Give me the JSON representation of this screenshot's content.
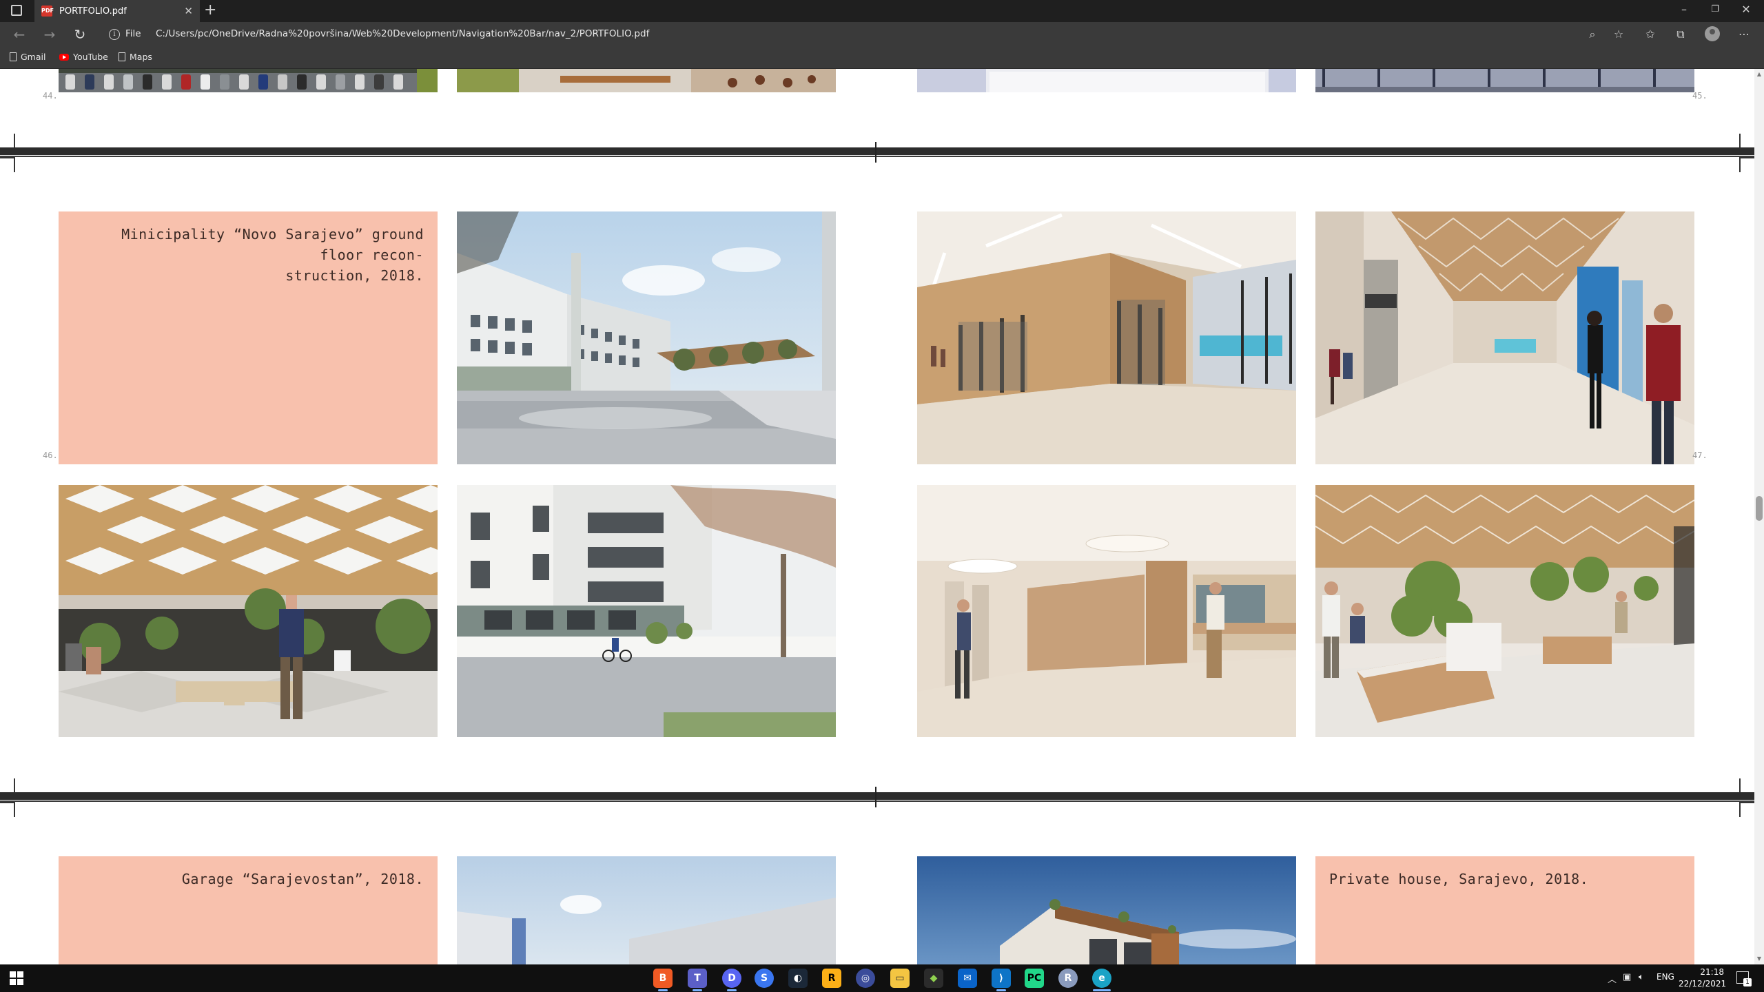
{
  "browser": {
    "tab_title": "PORTFOLIO.pdf",
    "protocol_label": "File",
    "url": "C:/Users/pc/OneDrive/Radna%20površina/Web%20Development/Navigation%20Bar/nav_2/PORTFOLIO.pdf",
    "bookmarks": [
      {
        "label": "Gmail",
        "icon": "page-icon"
      },
      {
        "label": "YouTube",
        "icon": "youtube-icon"
      },
      {
        "label": "Maps",
        "icon": "page-icon"
      }
    ]
  },
  "pdf": {
    "page_numbers": {
      "p44": "44.",
      "p45": "45.",
      "p46": "46.",
      "p47": "47."
    },
    "projects": [
      {
        "label": "Minicipality “Novo Sarajevo” ground floor recon-",
        "label_line2": "struction, 2018."
      },
      {
        "label": "Garage “Sarajevostan”, 2018."
      },
      {
        "label": "Private house, Sarajevo, 2018."
      }
    ],
    "images": [
      "parking-lot-render",
      "plaza-cafe-render",
      "interior-render",
      "facade-render",
      "municipality-exterior-render",
      "corridor-glass-offices-render",
      "atrium-hall-render",
      "covered-courtyard-render",
      "street-facade-render",
      "lobby-pendant-lights-render",
      "interior-garden-render",
      "garage-exterior-render",
      "private-house-render"
    ],
    "colors": {
      "panel": "#f8c1ad",
      "separator": "#2c2c2c"
    }
  },
  "taskbar": {
    "apps": [
      "brave-icon",
      "teams-icon",
      "discord-icon",
      "signal-icon",
      "steam-icon",
      "rockstar-icon",
      "obs-icon",
      "file-explorer-icon",
      "git-icon",
      "mail-icon",
      "vscode-icon",
      "pycharm-icon",
      "r-icon",
      "edge-icon"
    ],
    "language": "ENG",
    "time": "21:18",
    "date": "22/12/2021",
    "notifications": "1"
  }
}
